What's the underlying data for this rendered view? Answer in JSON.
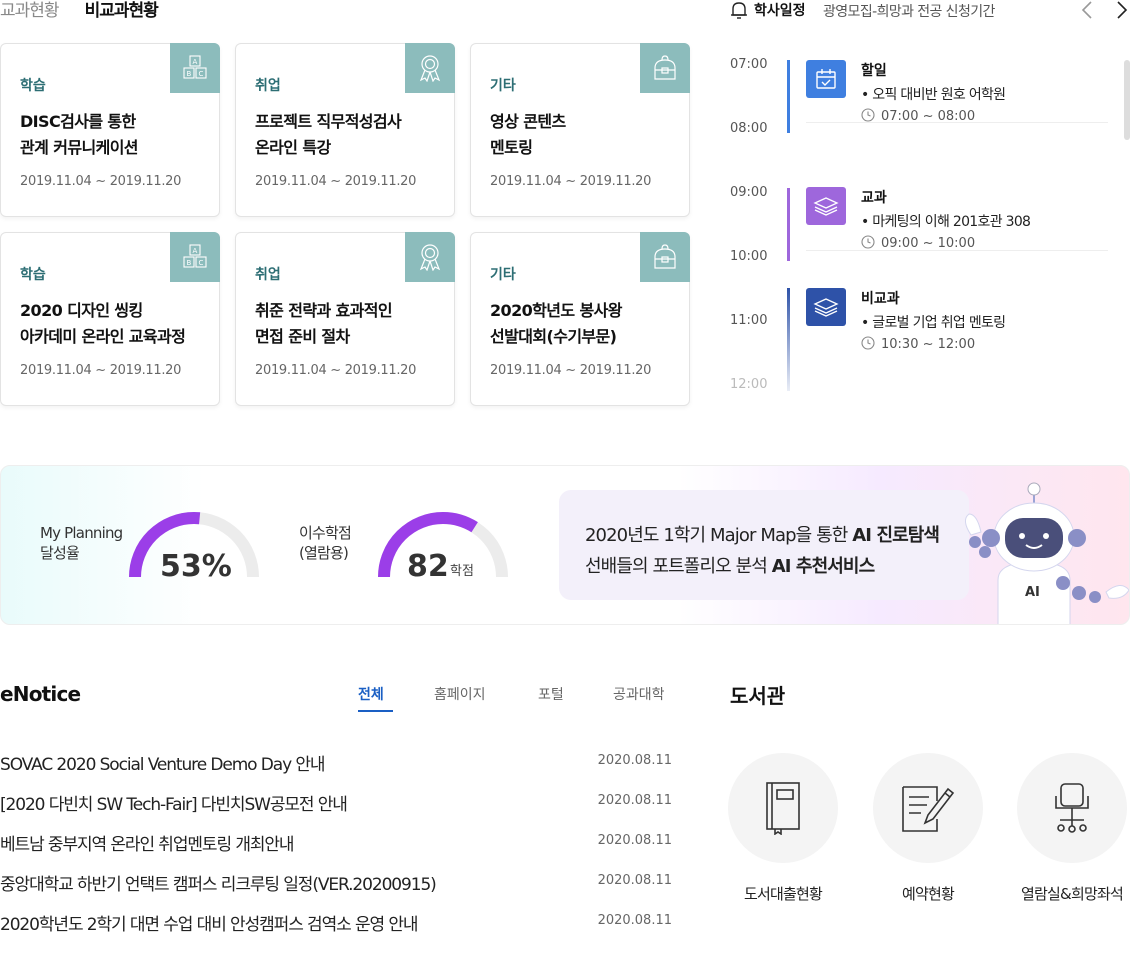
{
  "top_tabs": [
    "교과현황",
    "비교과현황"
  ],
  "cards": [
    {
      "category": "학습",
      "title1": "DISC검사를 통한",
      "title2": "관계 커뮤니케이션",
      "date": "2019.11.04 ~ 2019.11.20",
      "icon": "abc-blocks-icon"
    },
    {
      "category": "취업",
      "title1": "프로젝트 직무적성검사",
      "title2": "온라인 특강",
      "date": "2019.11.04 ~ 2019.11.20",
      "icon": "award-ribbon-icon"
    },
    {
      "category": "기타",
      "title1": "영상 콘텐츠",
      "title2": "멘토링",
      "date": "2019.11.04 ~ 2019.11.20",
      "icon": "backpack-icon"
    },
    {
      "category": "학습",
      "title1": "2020 디자인 씽킹",
      "title2": "아카데미 온라인 교육과정",
      "date": "2019.11.04 ~ 2019.11.20",
      "icon": "abc-blocks-icon"
    },
    {
      "category": "취업",
      "title1": "취준 전략과 효과적인",
      "title2": "면접 준비 절차",
      "date": "2019.11.04 ~ 2019.11.20",
      "icon": "award-ribbon-icon"
    },
    {
      "category": "기타",
      "title1": "2020학년도 봉사왕",
      "title2": "선발대회(수기부문)",
      "date": "2019.11.04 ~ 2019.11.20",
      "icon": "backpack-icon"
    }
  ],
  "schedule": {
    "label": "학사일정",
    "info": "광영모집-희망과 전공 신청기간",
    "times": [
      "07:00",
      "08:00",
      "09:00",
      "10:00",
      "11:00",
      "12:00"
    ],
    "events": [
      {
        "title": "할일",
        "desc": "• 오픽 대비반 원호 어학원",
        "time": "07:00 ~ 08:00",
        "color": "#3f7fe0",
        "icon": "calendar-check-icon"
      },
      {
        "title": "교과",
        "desc": "• 마케팅의 이해 201호관 308",
        "time": "09:00 ~ 10:00",
        "color": "#9e67dc",
        "icon": "book-stack-icon"
      },
      {
        "title": "비교과",
        "desc": "• 글로벌 기업 취업 멘토링",
        "time": "10:30 ~ 12:00",
        "color": "#2e52a8",
        "icon": "book-stack-icon"
      }
    ]
  },
  "banner": {
    "planning_label1": "My Planning",
    "planning_label2": "달성율",
    "planning_value": "53%",
    "planning_fraction": 0.53,
    "credit_label1": "이수학점",
    "credit_label2": "(열람용)",
    "credit_value": "82",
    "credit_unit": "학점",
    "credit_fraction": 0.68,
    "line1_pre": "2020년도 1학기 Major Map을 통한 ",
    "line1_bold": "AI 진로탐색",
    "line2_pre": "선배들의 포트폴리오 분석 ",
    "line2_bold": "AI 추천서비스",
    "robot_text": "AI"
  },
  "enotice": {
    "title": "eNotice",
    "tabs": [
      "전체",
      "홈페이지",
      "포털",
      "공과대학"
    ],
    "rows": [
      {
        "title": "SOVAC 2020 Social Venture Demo Day 안내",
        "date": "2020.08.11"
      },
      {
        "title": "[2020 다빈치 SW Tech-Fair] 다빈치SW공모전 안내",
        "date": "2020.08.11"
      },
      {
        "title": "베트남 중부지역 온라인 취업멘토링 개최안내",
        "date": "2020.08.11"
      },
      {
        "title": "중앙대학교 하반기 언택트 캠퍼스 리크루팅 일정(VER.20200915)",
        "date": "2020.08.11"
      },
      {
        "title": "2020학년도 2학기 대면 수업 대비 안성캠퍼스 검역소 운영 안내",
        "date": "2020.08.11"
      }
    ]
  },
  "library": {
    "title": "도서관",
    "items": [
      {
        "label": "도서대출현황",
        "icon": "book-icon"
      },
      {
        "label": "예약현황",
        "icon": "document-pen-icon"
      },
      {
        "label": "열람실&희망좌석",
        "icon": "chair-icon"
      }
    ]
  },
  "colors": {
    "accent_purple": "#9b3ee8",
    "card_corner": "#8cbcbc",
    "category_text": "#2d6e74",
    "notice_active": "#1a5fc4"
  }
}
